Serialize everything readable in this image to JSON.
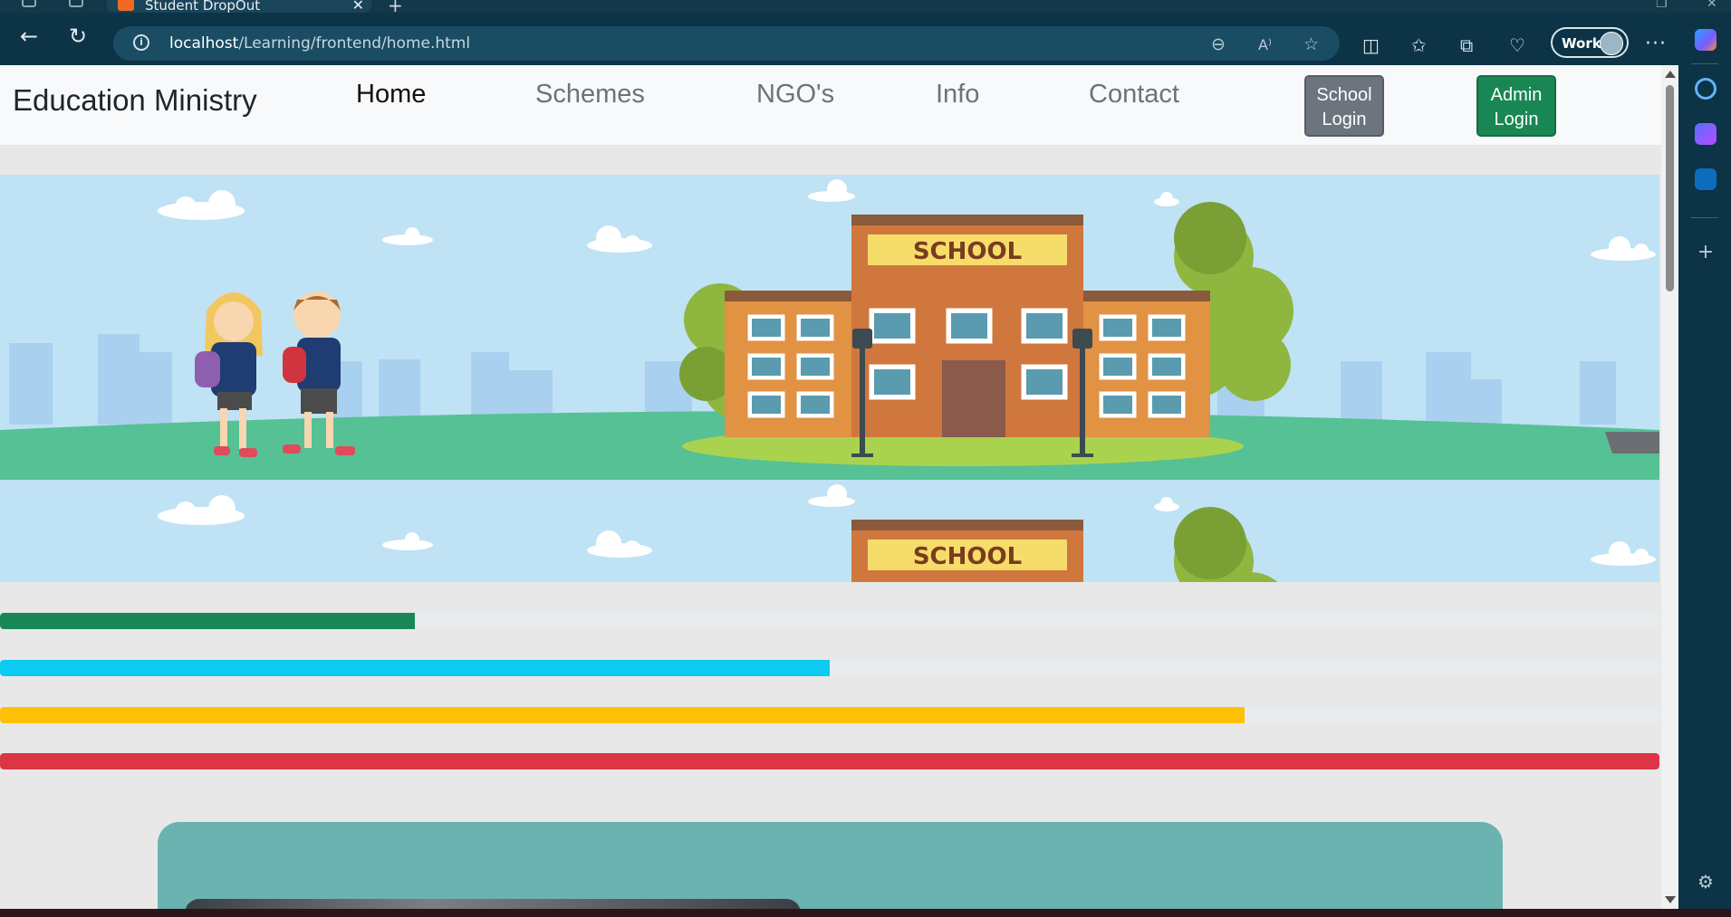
{
  "browser": {
    "tab_title": "Student DropOut",
    "url_host": "localhost",
    "url_path": "/Learning/frontend/home.html",
    "profile_label": "Work"
  },
  "navbar": {
    "brand": "Education Ministry",
    "links": [
      "Home",
      "Schemes",
      "NGO's",
      "Info",
      "Contact"
    ],
    "active_link": "Home",
    "school_login": "School Login",
    "admin_login": "Admin Login"
  },
  "hero": {
    "school_sign": "SCHOOL"
  },
  "progress_bars": [
    {
      "name": "progress-success",
      "color": "#198754",
      "percent": 25
    },
    {
      "name": "progress-info",
      "color": "#0dcaf0",
      "percent": 50
    },
    {
      "name": "progress-warning",
      "color": "#ffc107",
      "percent": 75
    },
    {
      "name": "progress-danger",
      "color": "#dc3545",
      "percent": 100
    }
  ],
  "colors": {
    "navbar_bg": "#f8f9fa",
    "page_bg": "#e8e8e8",
    "btn_secondary": "#6c757d",
    "btn_success": "#198754",
    "card_bg": "#6ab3b0"
  },
  "icons": {
    "back": "arrow-left-icon",
    "refresh": "refresh-icon",
    "site_info": "info-icon",
    "zoom_out": "zoom-out-icon",
    "read_aloud": "read-aloud-icon",
    "favorite": "star-icon",
    "split_screen": "split-screen-icon",
    "favorites": "favorites-list-icon",
    "collections": "collections-icon",
    "browser_essentials": "heart-pulse-icon",
    "more": "ellipsis-icon",
    "copilot": "copilot-icon",
    "sidebar_search": "search-icon",
    "sidebar_add": "plus-icon",
    "sidebar_settings": "gear-icon"
  }
}
